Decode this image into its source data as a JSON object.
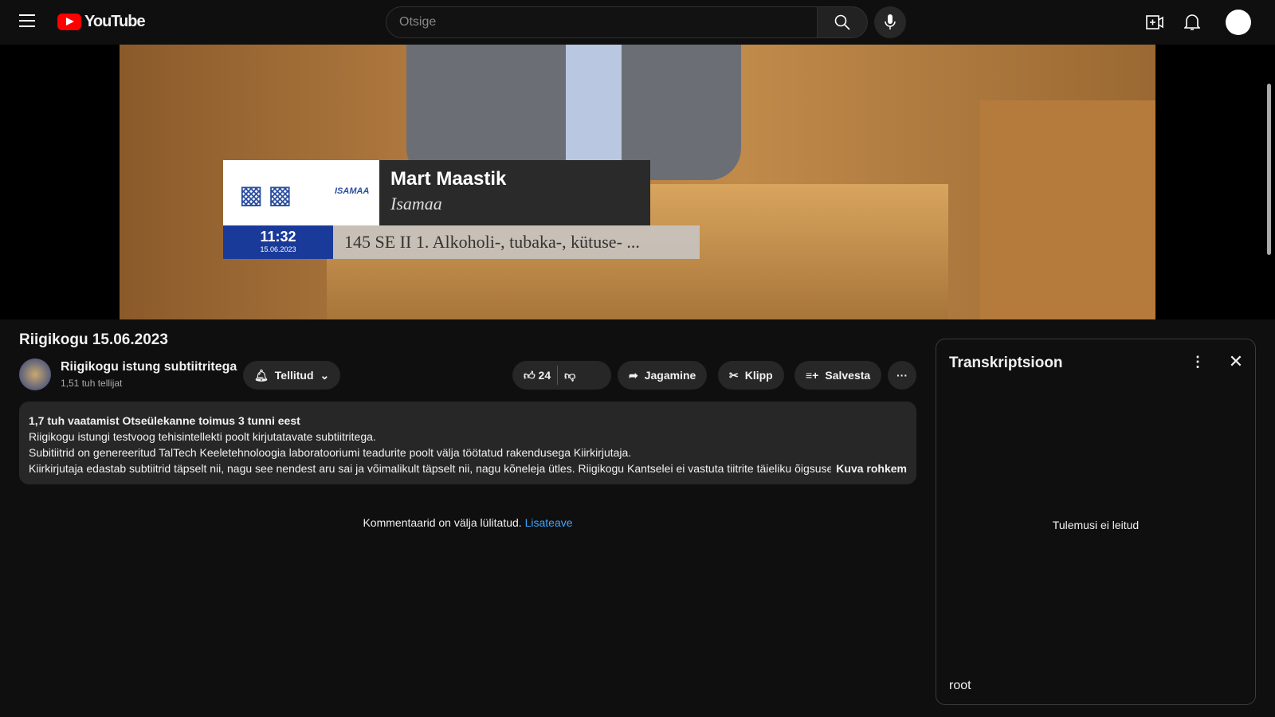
{
  "header": {
    "logo": "YouTube",
    "search_placeholder": "Otsige",
    "icons": [
      "menu-icon",
      "search-icon",
      "mic-icon",
      "create-icon",
      "bell-icon",
      "account-avatar"
    ]
  },
  "video": {
    "speaker_name": "Mart Maastik",
    "speaker_party": "Isamaa",
    "party_logo": "ISAMAA",
    "time": "11:32",
    "date": "15.06.2023",
    "agenda": "145 SE II 1. Alkoholi-, tubaka-, kütuse- ..."
  },
  "meta": {
    "title": "Riigikogu 15.06.2023",
    "channel": "Riigikogu istung subtiitritega",
    "subscribers": "1,51 tuh tellijat",
    "subscribe_label": "Tellitud",
    "likes": "24",
    "share": "Jagamine",
    "clip": "Klipp",
    "save": "Salvesta"
  },
  "description": {
    "stats": "1,7 tuh vaatamist  Otseülekanne toimus 3 tunni eest",
    "lines": [
      "Riigikogu istungi testvoog tehisintellekti poolt kirjutatavate subtiitritega.",
      "Subitiitrid on genereeritud TalTech Keeletehnoloogia laboratooriumi teadurite poolt välja töötatud rakendusega Kiirkirjutaja.",
      "Kiirkirjutaja edastab subtiitrid täpselt nii, nagu see nendest aru sai ja võimalikult täpselt nii, nagu kõneleja ütles. Riigikogu Kantselei ei vastuta tiitrite täieliku õigsuse"
    ],
    "show_more": "Kuva rohkem"
  },
  "comments": {
    "text": "Kommentaarid on välja lülitatud.",
    "link": "Lisateave"
  },
  "transcript": {
    "title": "Transkriptsioon",
    "empty": "Tulemusi ei leitud",
    "footer": "root"
  }
}
